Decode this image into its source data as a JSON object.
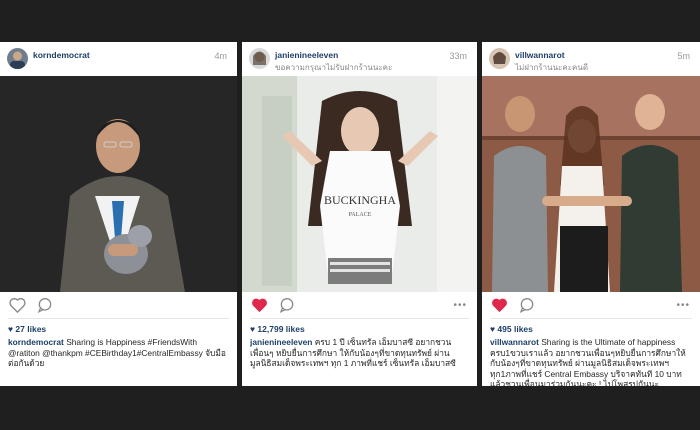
{
  "posts": [
    {
      "username": "korndemocrat",
      "subtitle": "",
      "time": "4m",
      "liked": false,
      "likes": "27 likes",
      "caption_user": "korndemocrat",
      "caption": "Sharing is Happiness #FriendsWith @ratiton @thankpm #CEBirthday1#CentralEmbassy จับมือต่อกันด้วย"
    },
    {
      "username": "janienineeleven",
      "subtitle": "ขอความกรุณาไม่รับฝากร้านนะคะ",
      "time": "33m",
      "liked": true,
      "likes": "12,799 likes",
      "caption_user": "janienineeleven",
      "caption": "ครบ 1 ปี เซ็นทรัล เอ็มบาสซี อยากชวนเพื่อนๆ หยิบยื่นการศึกษา ให้กับน้องๆที่ขาดทุนทรัพย์ ผ่านมูลนิธิสมเด็จพระเทพฯ ทุก 1 ภาพที่แชร์ เซ็นทรัล เอ็มบาสซี"
    },
    {
      "username": "villwannarot",
      "subtitle": "ไม่ฝากร้านนะคะคนดี",
      "time": "5m",
      "liked": true,
      "likes": "495 likes",
      "caption_user": "villwannarot",
      "caption": "Sharing is the Ultimate of happiness ครบ1ขวบเราแล้ว อยากชวนเพื่อนๆหยิบยื่นการศึกษาให้กับน้องๆที่ขาดทุนทรัพย์ ผ่านมูลนิธิสมเด็จพระเทพฯ ทุก1ภาพที่แชร์ Central Embassy บริจาคทันที 10 บาท แล้วชวนเพื่อนมาร่วมกันนะคะ ! ไปโพสรูปกันนะ"
    }
  ],
  "icons": {
    "heart_liked_color": "#e0284a",
    "heart_empty_color": "#8a8a8a",
    "more": "•••"
  }
}
